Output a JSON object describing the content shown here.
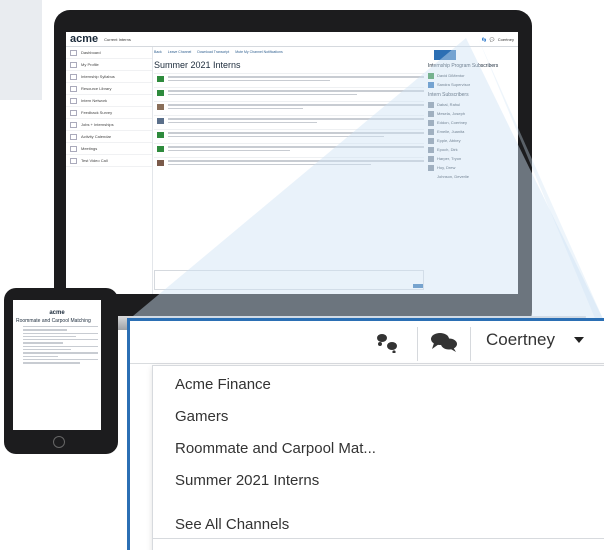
{
  "laptop_app": {
    "logo": "acme",
    "current_label": "Current Interns",
    "user_name_small": "Coertney",
    "toolbar": [
      "Back",
      "Leave Channel",
      "Download Transcript",
      "Mute My Channel Notifications",
      "Show/Hide Sidebar"
    ],
    "sidebar": [
      "Dashboard",
      "My Profile",
      "Internship Syllabus",
      "Resource Library",
      "Intern Network",
      "Feedback Survey",
      "Jobs + Internships",
      "Activity Calendar",
      "Meetings",
      "Test Video Call"
    ],
    "channel_title": "Summer 2021 Interns",
    "right_panel": {
      "heading_1": "Internship Program Subscribers",
      "subscribers_1": [
        "David DiMentor",
        "Sandra Supervisor"
      ],
      "heading_2": "Intern Subscribers",
      "subscribers_2": [
        "Dabal, Rahul",
        "Mesela, Joseph",
        "Eddon, Coertney",
        "Emelle, Juanita",
        "Epple, Abbey",
        "Epoch, Dirk",
        "Harper, Tryon",
        "Hoy, Drew",
        "Johnson, Deverlie"
      ]
    }
  },
  "tablet_app": {
    "logo": "acme",
    "channel_title": "Roommate and Carpool Matching"
  },
  "zoom": {
    "user_name": "Coertney",
    "menu_items": [
      "Acme Finance",
      "Gamers",
      "Roommate and Carpool Mat...",
      "Summer 2021 Interns"
    ],
    "see_all": "See All Channels"
  },
  "colors": {
    "accent_border": "#2b6fb4",
    "device": "#1c1c1e",
    "brand_text": "#1b2a3a",
    "avatar_green": "#2e8b3d"
  },
  "icons": [
    "footprints-icon",
    "chat-bubbles-icon",
    "caret-down-icon"
  ]
}
